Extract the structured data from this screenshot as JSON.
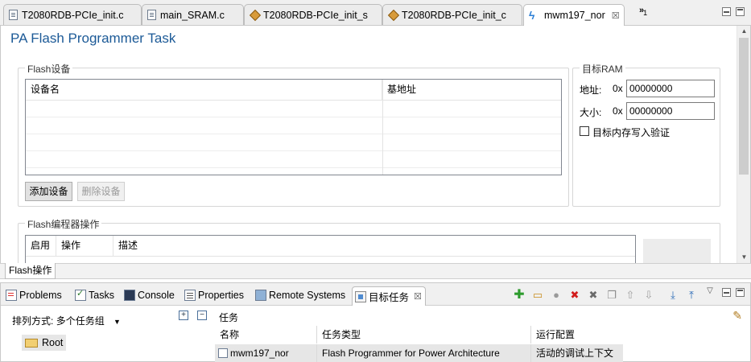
{
  "editor_tabs": [
    {
      "label": "T2080RDB-PCIe_init.c",
      "icon": "c-file-icon"
    },
    {
      "label": "main_SRAM.c",
      "icon": "c-file-icon"
    },
    {
      "label": "T2080RDB-PCIe_init_s",
      "icon": "asm-file-icon"
    },
    {
      "label": "T2080RDB-PCIe_init_c",
      "icon": "asm-file-icon"
    },
    {
      "label": "mwm197_nor",
      "icon": "flash-task-icon",
      "active": true
    }
  ],
  "overflow_count": "1",
  "page_title": "PA Flash Programmer Task",
  "flash_devices": {
    "group_label": "Flash设备",
    "columns": [
      "设备名",
      "基地址"
    ],
    "rows": [],
    "add_button": "添加设备",
    "remove_button": "删除设备"
  },
  "target_ram": {
    "group_label": "目标RAM",
    "address_label": "地址:",
    "address_prefix": "0x",
    "address_value": "00000000",
    "size_label": "大小:",
    "size_prefix": "0x",
    "size_value": "00000000",
    "verify_label": "目标内存写入验证",
    "verify_checked": false
  },
  "flash_ops": {
    "group_label": "Flash编程器操作",
    "columns": [
      "启用",
      "操作",
      "描述"
    ]
  },
  "form_tab": "Flash操作",
  "view_tabs": [
    {
      "label": "Problems",
      "icon": "problems-icon"
    },
    {
      "label": "Tasks",
      "icon": "tasks-icon"
    },
    {
      "label": "Console",
      "icon": "console-icon"
    },
    {
      "label": "Properties",
      "icon": "properties-icon"
    },
    {
      "label": "Remote Systems",
      "icon": "remote-systems-icon"
    },
    {
      "label": "目标任务",
      "icon": "target-tasks-icon",
      "active": true
    }
  ],
  "toolbar_icons": [
    "add-icon",
    "open-folder-icon",
    "run-icon",
    "delete-icon",
    "delete-all-icon",
    "copy-icon",
    "move-up-icon",
    "move-down-icon",
    "import-icon",
    "export-icon"
  ],
  "sort": {
    "label": "排列方式:",
    "value": "多个任务组"
  },
  "tree": {
    "root": "Root"
  },
  "tasks_panel": {
    "title": "任务",
    "columns": [
      "名称",
      "任务类型",
      "运行配置"
    ],
    "rows": [
      {
        "name": "mwm197_nor",
        "type": "Flash Programmer for Power Architecture",
        "config": "活动的调试上下文"
      }
    ]
  }
}
